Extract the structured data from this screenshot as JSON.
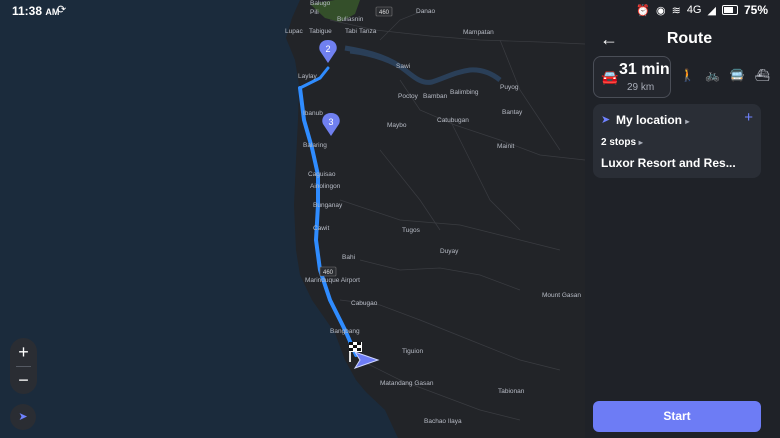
{
  "status_bar": {
    "time": "11:38",
    "time_suffix": "AM",
    "network": "4G",
    "battery": "75%"
  },
  "panel": {
    "title": "Route",
    "eta": {
      "time": "31 min",
      "distance": "29 km"
    },
    "origin": "My location",
    "stops": "2 stops",
    "destination": "Luxor Resort and Res...",
    "start_label": "Start"
  },
  "map": {
    "waypoints": [
      "2",
      "3"
    ],
    "labels": [
      "Balugo",
      "Pili",
      "Buliasnin",
      "Danao",
      "Lupac",
      "Tabigue",
      "Tabi",
      "Tanza",
      "Mampatan",
      "Sawi",
      "Laylay",
      "Poctoy",
      "Bamban",
      "Balimbing",
      "Puyog",
      "Ibanub",
      "Maybo",
      "Catubugan",
      "Bantay",
      "Balaring",
      "Mainit",
      "Caguisao",
      "Ainolingon",
      "Bunganay",
      "Cawit",
      "Tugos",
      "Duyay",
      "Bahi",
      "Marinduque Airport",
      "Cabugao",
      "Mount Gasan",
      "Bangbang",
      "Tiguion",
      "Matandang Gasan",
      "Tabionan",
      "Bachao Ilaya"
    ],
    "road_number": "460",
    "colors": {
      "route": "#2f8cff",
      "water": "#1b2b3c",
      "land": "#222428",
      "pin": "#7080f0"
    }
  }
}
